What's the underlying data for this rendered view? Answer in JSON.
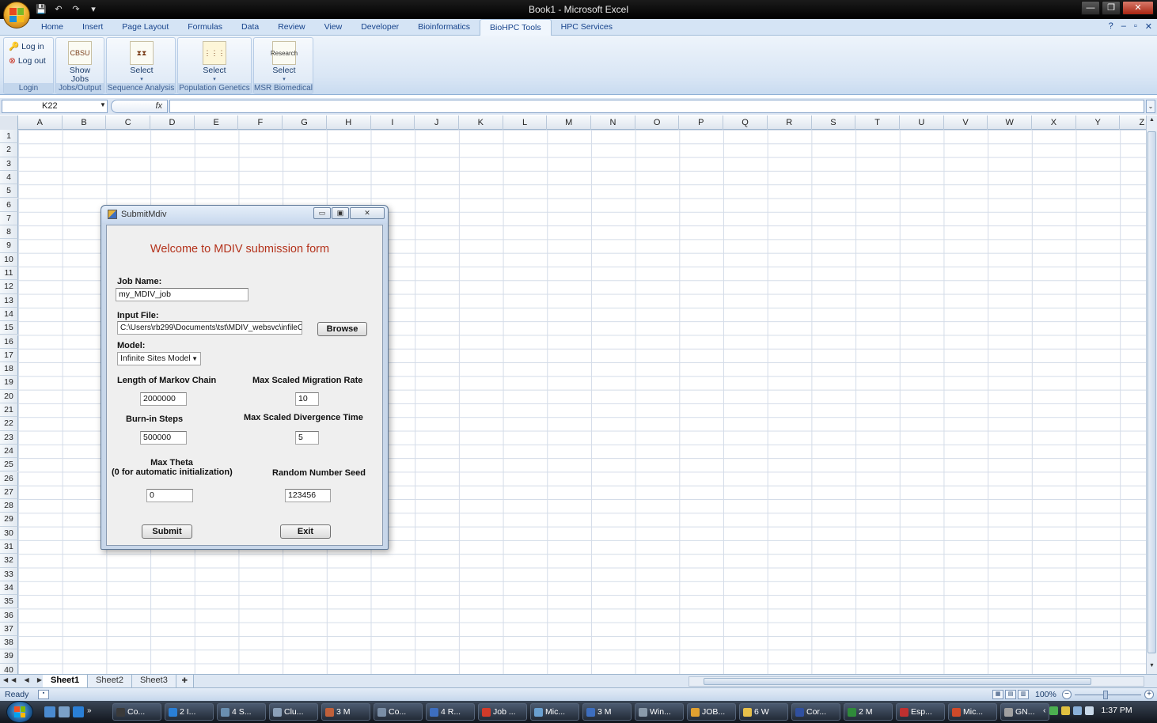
{
  "window": {
    "title": "Book1 - Microsoft Excel",
    "controls": {
      "minimize": "—",
      "restore": "❐",
      "close": "✕"
    }
  },
  "qat": {
    "save": "💾",
    "undo": "↶",
    "redo": "↷",
    "more": "▾"
  },
  "ribbon": {
    "tabs": [
      "Home",
      "Insert",
      "Page Layout",
      "Formulas",
      "Data",
      "Review",
      "View",
      "Developer",
      "Bioinformatics",
      "BioHPC Tools",
      "HPC Services"
    ],
    "active_tab": "BioHPC Tools",
    "groups": {
      "login": {
        "label": "Login",
        "login_button": "Log in",
        "logout_button": "Log out"
      },
      "jobs": {
        "label": "Jobs/Output",
        "button_line1": "Show",
        "button_line2": "Jobs",
        "icon_text": "CBSU"
      },
      "sequence": {
        "label": "Sequence Analysis",
        "button": "Select"
      },
      "population": {
        "label": "Population Genetics",
        "button": "Select"
      },
      "msr": {
        "label": "MSR Biomedical",
        "button": "Select",
        "icon_text": "Research"
      }
    }
  },
  "formula_bar": {
    "name_box": "K22",
    "fx": "fx",
    "formula": ""
  },
  "grid": {
    "columns": [
      "A",
      "B",
      "C",
      "D",
      "E",
      "F",
      "G",
      "H",
      "I",
      "J",
      "K",
      "L",
      "M",
      "N",
      "O",
      "P",
      "Q",
      "R",
      "S",
      "T",
      "U",
      "V",
      "W",
      "X",
      "Y",
      "Z"
    ],
    "rows": [
      "1",
      "2",
      "3",
      "4",
      "5",
      "6",
      "7",
      "8",
      "9",
      "10",
      "11",
      "12",
      "13",
      "14",
      "15",
      "16",
      "17",
      "18",
      "19",
      "20",
      "21",
      "22",
      "23",
      "24",
      "25",
      "26",
      "27",
      "28",
      "29",
      "30",
      "31",
      "32",
      "33",
      "34",
      "35",
      "36",
      "37",
      "38",
      "39",
      "40"
    ]
  },
  "sheets": {
    "tabs": [
      "Sheet1",
      "Sheet2",
      "Sheet3"
    ],
    "active": "Sheet1"
  },
  "status": {
    "ready": "Ready",
    "zoom": "100%"
  },
  "dialog": {
    "title": "SubmitMdiv",
    "welcome": "Welcome to MDIV submission form",
    "job_name_label": "Job Name:",
    "job_name_value": "my_MDIV_job",
    "input_file_label": "Input File:",
    "input_file_value": "C:\\Users\\rb299\\Documents\\tst\\MDIV_websvc\\infileC",
    "browse_button": "Browse",
    "model_label": "Model:",
    "model_value": "Infinite Sites Model",
    "markov_label": "Length of Markov Chain",
    "markov_value": "2000000",
    "migration_label": "Max Scaled Migration Rate",
    "migration_value": "10",
    "burnin_label": "Burn-in Steps",
    "burnin_value": "500000",
    "divergence_label": "Max Scaled Divergence Time",
    "divergence_value": "5",
    "theta_label_line1": "Max Theta",
    "theta_label_line2": "(0 for automatic initialization)",
    "theta_value": "0",
    "seed_label": "Random Number Seed",
    "seed_value": "123456",
    "submit_button": "Submit",
    "exit_button": "Exit"
  },
  "taskbar": {
    "items": [
      {
        "label": "Co...",
        "icon_color": "#3a3a3a"
      },
      {
        "label": "2 I...",
        "icon_color": "#2a7fd6"
      },
      {
        "label": "4 S...",
        "icon_color": "#6a8fb0"
      },
      {
        "label": "Clu...",
        "icon_color": "#8ba0b8"
      },
      {
        "label": "3 M",
        "icon_color": "#c0603a"
      },
      {
        "label": "Co...",
        "icon_color": "#7a8ea6"
      },
      {
        "label": "4 R...",
        "icon_color": "#3d6ebf"
      },
      {
        "label": "Job ...",
        "icon_color": "#d23b2a"
      },
      {
        "label": "Mic...",
        "icon_color": "#6aa0d0"
      },
      {
        "label": "3 M",
        "icon_color": "#3d6ebf"
      },
      {
        "label": "Win...",
        "icon_color": "#8a9aaa"
      },
      {
        "label": "JOB...",
        "icon_color": "#e0a030"
      },
      {
        "label": "6 W",
        "icon_color": "#e8c04a"
      },
      {
        "label": "Cor...",
        "icon_color": "#3050a0"
      },
      {
        "label": "2 M",
        "icon_color": "#2f8a3a"
      },
      {
        "label": "Esp...",
        "icon_color": "#c03030"
      },
      {
        "label": "Mic...",
        "icon_color": "#d04a2a"
      },
      {
        "label": "GN...",
        "icon_color": "#a0a0a0"
      }
    ],
    "clock": "1:37 PM"
  }
}
